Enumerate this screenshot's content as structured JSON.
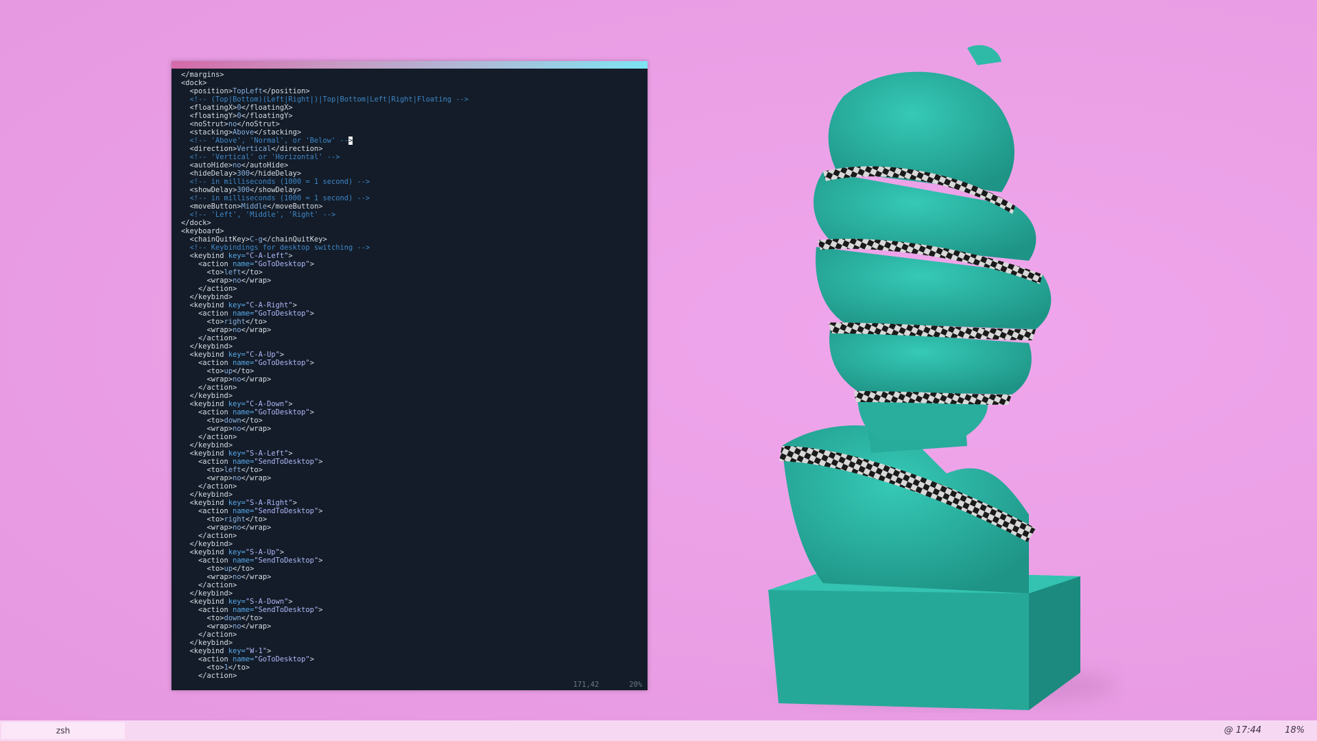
{
  "taskbar": {
    "task_label": "zsh",
    "clock": "@ 17:44",
    "battery": "18%"
  },
  "terminal": {
    "status_position": "171,42",
    "status_percent": "20%",
    "lines": [
      [
        [
          "t",
          "</margins>"
        ]
      ],
      [
        [
          "t",
          "<dock>"
        ]
      ],
      [
        [
          "t",
          "  <position>"
        ],
        [
          "v",
          "TopLeft"
        ],
        [
          "t",
          "</position>"
        ]
      ],
      [
        [
          "c",
          "  <!-- (Top|Bottom)(Left|Right|)|Top|Bottom|Left|Right|Floating -->"
        ]
      ],
      [
        [
          "t",
          "  <floatingX>"
        ],
        [
          "v",
          "0"
        ],
        [
          "t",
          "</floatingX>"
        ]
      ],
      [
        [
          "t",
          "  <floatingY>"
        ],
        [
          "v",
          "0"
        ],
        [
          "t",
          "</floatingY>"
        ]
      ],
      [
        [
          "t",
          "  <noStrut>"
        ],
        [
          "v",
          "no"
        ],
        [
          "t",
          "</noStrut>"
        ]
      ],
      [
        [
          "t",
          "  <stacking>"
        ],
        [
          "v",
          "Above"
        ],
        [
          "t",
          "</stacking>"
        ]
      ],
      [
        [
          "c",
          "  <!-- 'Above', 'Normal', or 'Below' --"
        ],
        [
          "k",
          ">"
        ]
      ],
      [
        [
          "t",
          "  <direction>"
        ],
        [
          "v",
          "Vertical"
        ],
        [
          "t",
          "</direction>"
        ]
      ],
      [
        [
          "c",
          "  <!-- 'Vertical' or 'Horizontal' -->"
        ]
      ],
      [
        [
          "t",
          "  <autoHide>"
        ],
        [
          "v",
          "no"
        ],
        [
          "t",
          "</autoHide>"
        ]
      ],
      [
        [
          "t",
          "  <hideDelay>"
        ],
        [
          "v",
          "300"
        ],
        [
          "t",
          "</hideDelay>"
        ]
      ],
      [
        [
          "c",
          "  <!-- in milliseconds (1000 = 1 second) -->"
        ]
      ],
      [
        [
          "t",
          "  <showDelay>"
        ],
        [
          "v",
          "300"
        ],
        [
          "t",
          "</showDelay>"
        ]
      ],
      [
        [
          "c",
          "  <!-- in milliseconds (1000 = 1 second) -->"
        ]
      ],
      [
        [
          "t",
          "  <moveButton>"
        ],
        [
          "v",
          "Middle"
        ],
        [
          "t",
          "</moveButton>"
        ]
      ],
      [
        [
          "c",
          "  <!-- 'Left', 'Middle', 'Right' -->"
        ]
      ],
      [
        [
          "t",
          "</dock>"
        ]
      ],
      [
        [
          "t",
          "<keyboard>"
        ]
      ],
      [
        [
          "t",
          "  <chainQuitKey>"
        ],
        [
          "v",
          "C-g"
        ],
        [
          "t",
          "</chainQuitKey>"
        ]
      ],
      [
        [
          "c",
          "  <!-- Keybindings for desktop switching -->"
        ]
      ],
      [
        [
          "t",
          "  <keybind "
        ],
        [
          "a",
          "key="
        ],
        [
          "s",
          "\"C-A-Left\""
        ],
        [
          "t",
          ">"
        ]
      ],
      [
        [
          "t",
          "    <action "
        ],
        [
          "a",
          "name="
        ],
        [
          "s",
          "\"GoToDesktop\""
        ],
        [
          "t",
          ">"
        ]
      ],
      [
        [
          "t",
          "      <to>"
        ],
        [
          "v",
          "left"
        ],
        [
          "t",
          "</to>"
        ]
      ],
      [
        [
          "t",
          "      <wrap>"
        ],
        [
          "v",
          "no"
        ],
        [
          "t",
          "</wrap>"
        ]
      ],
      [
        [
          "t",
          "    </action>"
        ]
      ],
      [
        [
          "t",
          "  </keybind>"
        ]
      ],
      [
        [
          "t",
          "  <keybind "
        ],
        [
          "a",
          "key="
        ],
        [
          "s",
          "\"C-A-Right\""
        ],
        [
          "t",
          ">"
        ]
      ],
      [
        [
          "t",
          "    <action "
        ],
        [
          "a",
          "name="
        ],
        [
          "s",
          "\"GoToDesktop\""
        ],
        [
          "t",
          ">"
        ]
      ],
      [
        [
          "t",
          "      <to>"
        ],
        [
          "v",
          "right"
        ],
        [
          "t",
          "</to>"
        ]
      ],
      [
        [
          "t",
          "      <wrap>"
        ],
        [
          "v",
          "no"
        ],
        [
          "t",
          "</wrap>"
        ]
      ],
      [
        [
          "t",
          "    </action>"
        ]
      ],
      [
        [
          "t",
          "  </keybind>"
        ]
      ],
      [
        [
          "t",
          "  <keybind "
        ],
        [
          "a",
          "key="
        ],
        [
          "s",
          "\"C-A-Up\""
        ],
        [
          "t",
          ">"
        ]
      ],
      [
        [
          "t",
          "    <action "
        ],
        [
          "a",
          "name="
        ],
        [
          "s",
          "\"GoToDesktop\""
        ],
        [
          "t",
          ">"
        ]
      ],
      [
        [
          "t",
          "      <to>"
        ],
        [
          "v",
          "up"
        ],
        [
          "t",
          "</to>"
        ]
      ],
      [
        [
          "t",
          "      <wrap>"
        ],
        [
          "v",
          "no"
        ],
        [
          "t",
          "</wrap>"
        ]
      ],
      [
        [
          "t",
          "    </action>"
        ]
      ],
      [
        [
          "t",
          "  </keybind>"
        ]
      ],
      [
        [
          "t",
          "  <keybind "
        ],
        [
          "a",
          "key="
        ],
        [
          "s",
          "\"C-A-Down\""
        ],
        [
          "t",
          ">"
        ]
      ],
      [
        [
          "t",
          "    <action "
        ],
        [
          "a",
          "name="
        ],
        [
          "s",
          "\"GoToDesktop\""
        ],
        [
          "t",
          ">"
        ]
      ],
      [
        [
          "t",
          "      <to>"
        ],
        [
          "v",
          "down"
        ],
        [
          "t",
          "</to>"
        ]
      ],
      [
        [
          "t",
          "      <wrap>"
        ],
        [
          "v",
          "no"
        ],
        [
          "t",
          "</wrap>"
        ]
      ],
      [
        [
          "t",
          "    </action>"
        ]
      ],
      [
        [
          "t",
          "  </keybind>"
        ]
      ],
      [
        [
          "t",
          "  <keybind "
        ],
        [
          "a",
          "key="
        ],
        [
          "s",
          "\"S-A-Left\""
        ],
        [
          "t",
          ">"
        ]
      ],
      [
        [
          "t",
          "    <action "
        ],
        [
          "a",
          "name="
        ],
        [
          "s",
          "\"SendToDesktop\""
        ],
        [
          "t",
          ">"
        ]
      ],
      [
        [
          "t",
          "      <to>"
        ],
        [
          "v",
          "left"
        ],
        [
          "t",
          "</to>"
        ]
      ],
      [
        [
          "t",
          "      <wrap>"
        ],
        [
          "v",
          "no"
        ],
        [
          "t",
          "</wrap>"
        ]
      ],
      [
        [
          "t",
          "    </action>"
        ]
      ],
      [
        [
          "t",
          "  </keybind>"
        ]
      ],
      [
        [
          "t",
          "  <keybind "
        ],
        [
          "a",
          "key="
        ],
        [
          "s",
          "\"S-A-Right\""
        ],
        [
          "t",
          ">"
        ]
      ],
      [
        [
          "t",
          "    <action "
        ],
        [
          "a",
          "name="
        ],
        [
          "s",
          "\"SendToDesktop\""
        ],
        [
          "t",
          ">"
        ]
      ],
      [
        [
          "t",
          "      <to>"
        ],
        [
          "v",
          "right"
        ],
        [
          "t",
          "</to>"
        ]
      ],
      [
        [
          "t",
          "      <wrap>"
        ],
        [
          "v",
          "no"
        ],
        [
          "t",
          "</wrap>"
        ]
      ],
      [
        [
          "t",
          "    </action>"
        ]
      ],
      [
        [
          "t",
          "  </keybind>"
        ]
      ],
      [
        [
          "t",
          "  <keybind "
        ],
        [
          "a",
          "key="
        ],
        [
          "s",
          "\"S-A-Up\""
        ],
        [
          "t",
          ">"
        ]
      ],
      [
        [
          "t",
          "    <action "
        ],
        [
          "a",
          "name="
        ],
        [
          "s",
          "\"SendToDesktop\""
        ],
        [
          "t",
          ">"
        ]
      ],
      [
        [
          "t",
          "      <to>"
        ],
        [
          "v",
          "up"
        ],
        [
          "t",
          "</to>"
        ]
      ],
      [
        [
          "t",
          "      <wrap>"
        ],
        [
          "v",
          "no"
        ],
        [
          "t",
          "</wrap>"
        ]
      ],
      [
        [
          "t",
          "    </action>"
        ]
      ],
      [
        [
          "t",
          "  </keybind>"
        ]
      ],
      [
        [
          "t",
          "  <keybind "
        ],
        [
          "a",
          "key="
        ],
        [
          "s",
          "\"S-A-Down\""
        ],
        [
          "t",
          ">"
        ]
      ],
      [
        [
          "t",
          "    <action "
        ],
        [
          "a",
          "name="
        ],
        [
          "s",
          "\"SendToDesktop\""
        ],
        [
          "t",
          ">"
        ]
      ],
      [
        [
          "t",
          "      <to>"
        ],
        [
          "v",
          "down"
        ],
        [
          "t",
          "</to>"
        ]
      ],
      [
        [
          "t",
          "      <wrap>"
        ],
        [
          "v",
          "no"
        ],
        [
          "t",
          "</wrap>"
        ]
      ],
      [
        [
          "t",
          "    </action>"
        ]
      ],
      [
        [
          "t",
          "  </keybind>"
        ]
      ],
      [
        [
          "t",
          "  <keybind "
        ],
        [
          "a",
          "key="
        ],
        [
          "s",
          "\"W-1\""
        ],
        [
          "t",
          ">"
        ]
      ],
      [
        [
          "t",
          "    <action "
        ],
        [
          "a",
          "name="
        ],
        [
          "s",
          "\"GoToDesktop\""
        ],
        [
          "t",
          ">"
        ]
      ],
      [
        [
          "t",
          "      <to>"
        ],
        [
          "v",
          "1"
        ],
        [
          "t",
          "</to>"
        ]
      ],
      [
        [
          "t",
          "    </action>"
        ]
      ]
    ]
  },
  "colors": {
    "wallpaper": "#eba0e6",
    "terminal_bg": "#131c28",
    "statue": "#2bb0a0",
    "taskbar": "#f7d8f3"
  }
}
